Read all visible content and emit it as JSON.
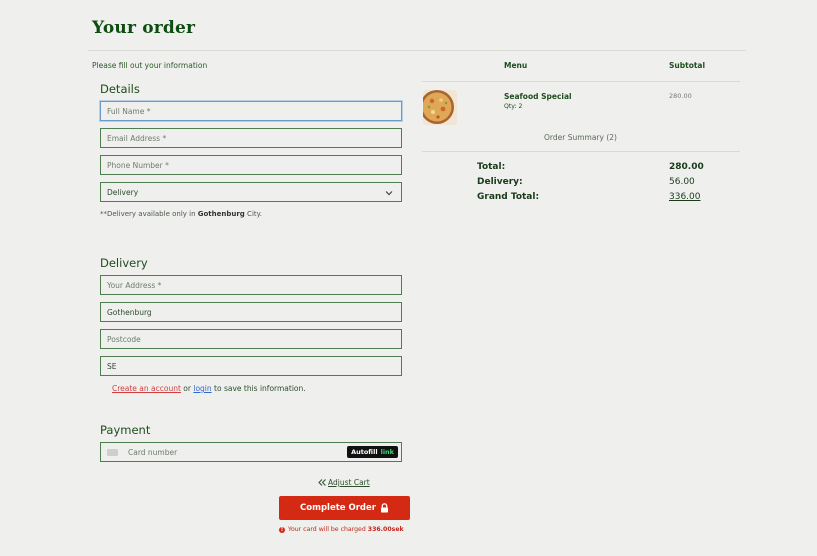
{
  "header": {
    "title": "Your order",
    "subtitle": "Please fill out your information"
  },
  "details": {
    "title": "Details",
    "full_name_placeholder": "Full Name *",
    "email_placeholder": "Email Address *",
    "phone_placeholder": "Phone Number *",
    "method_value": "Delivery",
    "note_prefix": "**Delivery available only in ",
    "note_city": "Gothenburg",
    "note_suffix": " City."
  },
  "delivery": {
    "title": "Delivery",
    "address_placeholder": "Your Address *",
    "city_value": "Gothenburg",
    "postcode_placeholder": "Postcode",
    "country_value": "SE",
    "save_create": "Create an account",
    "save_or": " or ",
    "save_login": "login",
    "save_suffix": " to save this information."
  },
  "payment": {
    "title": "Payment",
    "card_placeholder": "Card number",
    "autofill_label": "Autofill",
    "autofill_link": "link"
  },
  "actions": {
    "adjust_cart": "Adjust Cart",
    "complete_order": "Complete Order",
    "charge_prefix": "Your card will be charged ",
    "charge_amount": "336.00sek"
  },
  "summary": {
    "col_menu": "Menu",
    "col_subtotal": "Subtotal",
    "item_name": "Seafood Special",
    "item_qty": "Qty: 2",
    "item_subtotal": "280.00",
    "order_summary": "Order Summary (2)",
    "total_label": "Total:",
    "total_value": "280.00",
    "delivery_label": "Delivery:",
    "delivery_value": "56.00",
    "grand_label": "Grand Total:",
    "grand_value": "336.00"
  },
  "colors": {
    "brand_green": "#0e4d12",
    "button_red": "#d42a14",
    "background": "#efefed"
  }
}
